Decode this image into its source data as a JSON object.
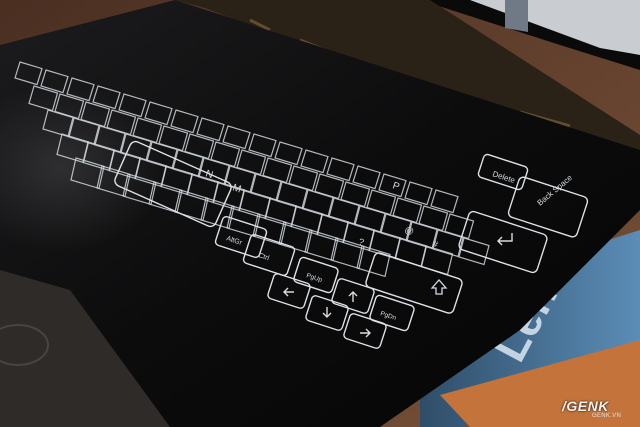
{
  "keys": [
    "Delete",
    "Back Space",
    "P",
    "M",
    "N",
    "AltGr",
    "Ctrl",
    "PgUp",
    "PgDn",
    "@",
    "#",
    "?"
  ],
  "box_brand": "Lenovo",
  "watermark": {
    "name": "GENK",
    "domain": "GENK.VN"
  },
  "colors": {
    "key_outline": "#cfd6dc",
    "deck": "#0b0b0c",
    "box_blue": "#4d7ea8",
    "box_orange": "#c4743a"
  }
}
